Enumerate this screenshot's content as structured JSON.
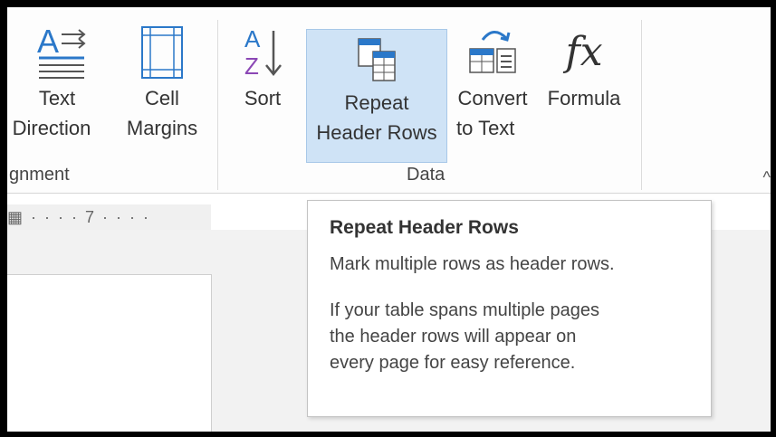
{
  "ribbon": {
    "buttons": {
      "text_direction": {
        "line1": "Text",
        "line2": "Direction"
      },
      "cell_margins": {
        "line1": "Cell",
        "line2": "Margins"
      },
      "sort": {
        "line1": "Sort"
      },
      "repeat_header_rows": {
        "line1": "Repeat",
        "line2": "Header Rows"
      },
      "convert_to_text": {
        "line1": "Convert",
        "line2": "to Text"
      },
      "formula": {
        "line1": "Formula",
        "glyph": "fx"
      }
    },
    "groups": {
      "alignment": "gnment",
      "data": "Data"
    },
    "collapse_glyph": "^"
  },
  "ruler": {
    "text": "▦  ·  ·  ·  ·  7  ·  ·  ·  ·"
  },
  "tooltip": {
    "title": "Repeat Header Rows",
    "line1": "Mark multiple rows as header rows.",
    "body": [
      "If your table spans multiple pages",
      "the header rows will appear on",
      "every page for easy reference."
    ]
  },
  "colors": {
    "accent_blue": "#2b78c9",
    "hover_fill": "#cfe3f6",
    "sort_purple": "#8b47b5"
  }
}
